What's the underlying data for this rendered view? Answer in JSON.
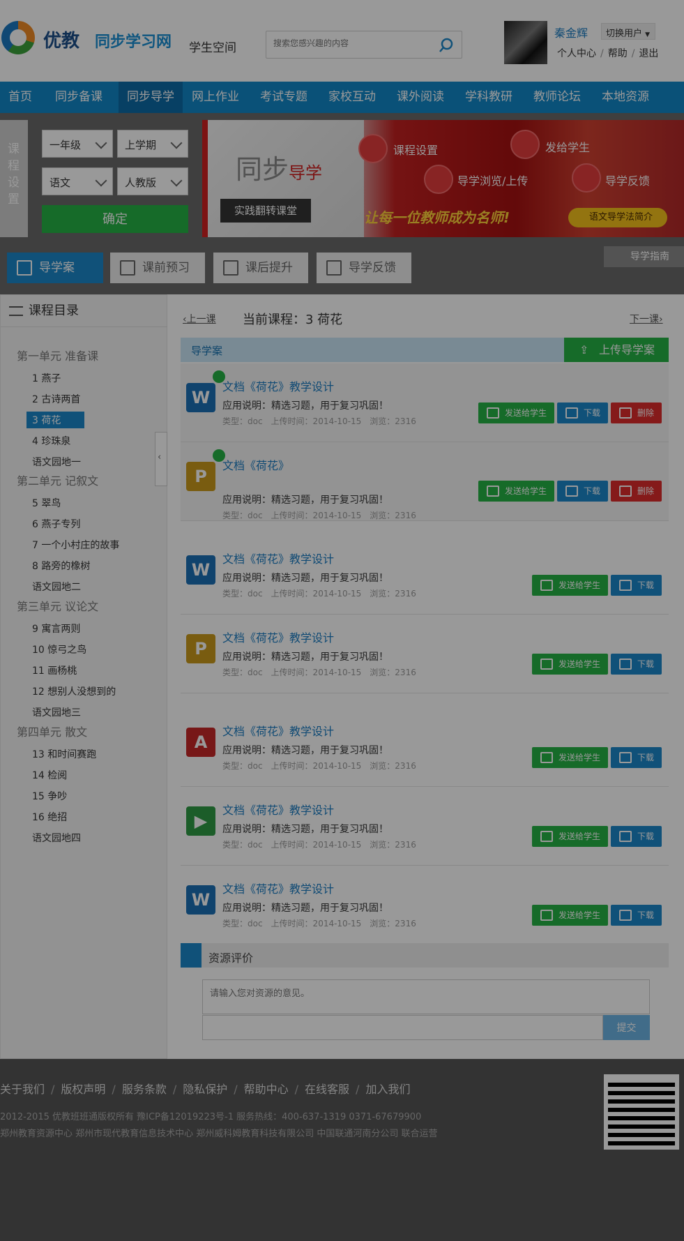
{
  "header": {
    "logo_brand": "优教",
    "logo_sub": "同步学习网",
    "space": "学生空间",
    "search_placeholder": "搜索您感兴趣的内容",
    "user_name": "秦金辉",
    "switch_user": "切换用户",
    "personal": "个人中心",
    "help": "帮助",
    "logout": "退出"
  },
  "nav": [
    "首页",
    "同步备课",
    "同步导学",
    "网上作业",
    "考试专题",
    "家校互动",
    "课外阅读",
    "学科教研",
    "教师论坛",
    "本地资源"
  ],
  "setting": {
    "label": "课程设置",
    "grade": "一年级",
    "term": "上学期",
    "subject": "语文",
    "edition": "人教版",
    "confirm": "确定"
  },
  "banner": {
    "title": "同步",
    "title_em": "导学",
    "tag": "实践翻转课堂",
    "step1": "课程设置",
    "step2": "发给学生",
    "step3": "导学浏览/上传",
    "step4": "导学反馈",
    "slogan": "让每一位教师成为名师!",
    "intro": "语文导学法简介"
  },
  "tabs": [
    "导学案",
    "课前预习",
    "课后提升",
    "导学反馈"
  ],
  "guide": "导学指南",
  "catalog": {
    "title": "课程目录",
    "units": [
      {
        "name": "第一单元 准备课",
        "lessons": [
          "1 燕子",
          "2 古诗两首",
          "3 荷花",
          "4 珍珠泉",
          "语文园地一"
        ]
      },
      {
        "name": "第二单元 记叙文",
        "lessons": [
          "5 翠鸟",
          "6 燕子专列",
          "7 一个小村庄的故事",
          "8 路旁的橡树",
          "语文园地二"
        ]
      },
      {
        "name": "第三单元 议论文",
        "lessons": [
          "9 寓言两则",
          "10 惊弓之鸟",
          "11 画杨桃",
          "12 想别人没想到的",
          "语文园地三"
        ]
      },
      {
        "name": "第四单元 散文",
        "lessons": [
          "13 和时间赛跑",
          "14 检阅",
          "15 争吵",
          "16 绝招",
          "语文园地四"
        ]
      }
    ]
  },
  "lesson_nav": {
    "prev": "上一课",
    "current": "当前课程：3 荷花",
    "next": "下一课"
  },
  "section": {
    "title": "导学案",
    "upload": "上传导学案"
  },
  "files": [
    {
      "icon": "W",
      "title": "文档《荷花》教学设计",
      "desc": "应用说明：精选习题，用于复习巩固！",
      "meta": "类型：doc　上传时间：2014-10-15　浏览：2316"
    },
    {
      "icon": "P",
      "title": "文档《荷花》",
      "desc": "应用说明：精选习题，用于复习巩固！",
      "meta": "类型：doc　上传时间：2014-10-15　浏览：2316"
    },
    {
      "icon": "W",
      "title": "文档《荷花》教学设计",
      "desc": "应用说明：精选习题，用于复习巩固！",
      "meta": "类型：doc　上传时间：2014-10-15　浏览：2316"
    },
    {
      "icon": "P",
      "title": "文档《荷花》教学设计",
      "desc": "应用说明：精选习题，用于复习巩固！",
      "meta": "类型：doc　上传时间：2014-10-15　浏览：2316"
    },
    {
      "icon": "A",
      "title": "文档《荷花》教学设计",
      "desc": "应用说明：精选习题，用于复习巩固！",
      "meta": "类型：doc　上传时间：2014-10-15　浏览：2316"
    },
    {
      "icon": "▶",
      "title": "文档《荷花》教学设计",
      "desc": "应用说明：精选习题，用于复习巩固！",
      "meta": "类型：doc　上传时间：2014-10-15　浏览：2316"
    },
    {
      "icon": "W",
      "title": "文档《荷花》教学设计",
      "desc": "应用说明：精选习题，用于复习巩固！",
      "meta": "类型：doc　上传时间：2014-10-15　浏览：2316"
    }
  ],
  "buttons": {
    "send": "发送给学生",
    "download": "下载",
    "delete": "删除"
  },
  "evaluation": {
    "title": "资源评价",
    "placeholder": "请输入您对资源的意见。",
    "submit": "提交"
  },
  "footer": {
    "links": [
      "关于我们",
      "版权声明",
      "服务条款",
      "隐私保护",
      "帮助中心",
      "在线客服",
      "加入我们"
    ],
    "copyright": "2012-2015 优教班班通版权所有  豫ICP备12019223号-1      服务热线：400-637-1319   0371-67679900",
    "orgs": "郑州教育资源中心    郑州市现代教育信息技术中心    郑州威科姆教育科技有限公司 中国联通河南分公司  联合运营"
  }
}
